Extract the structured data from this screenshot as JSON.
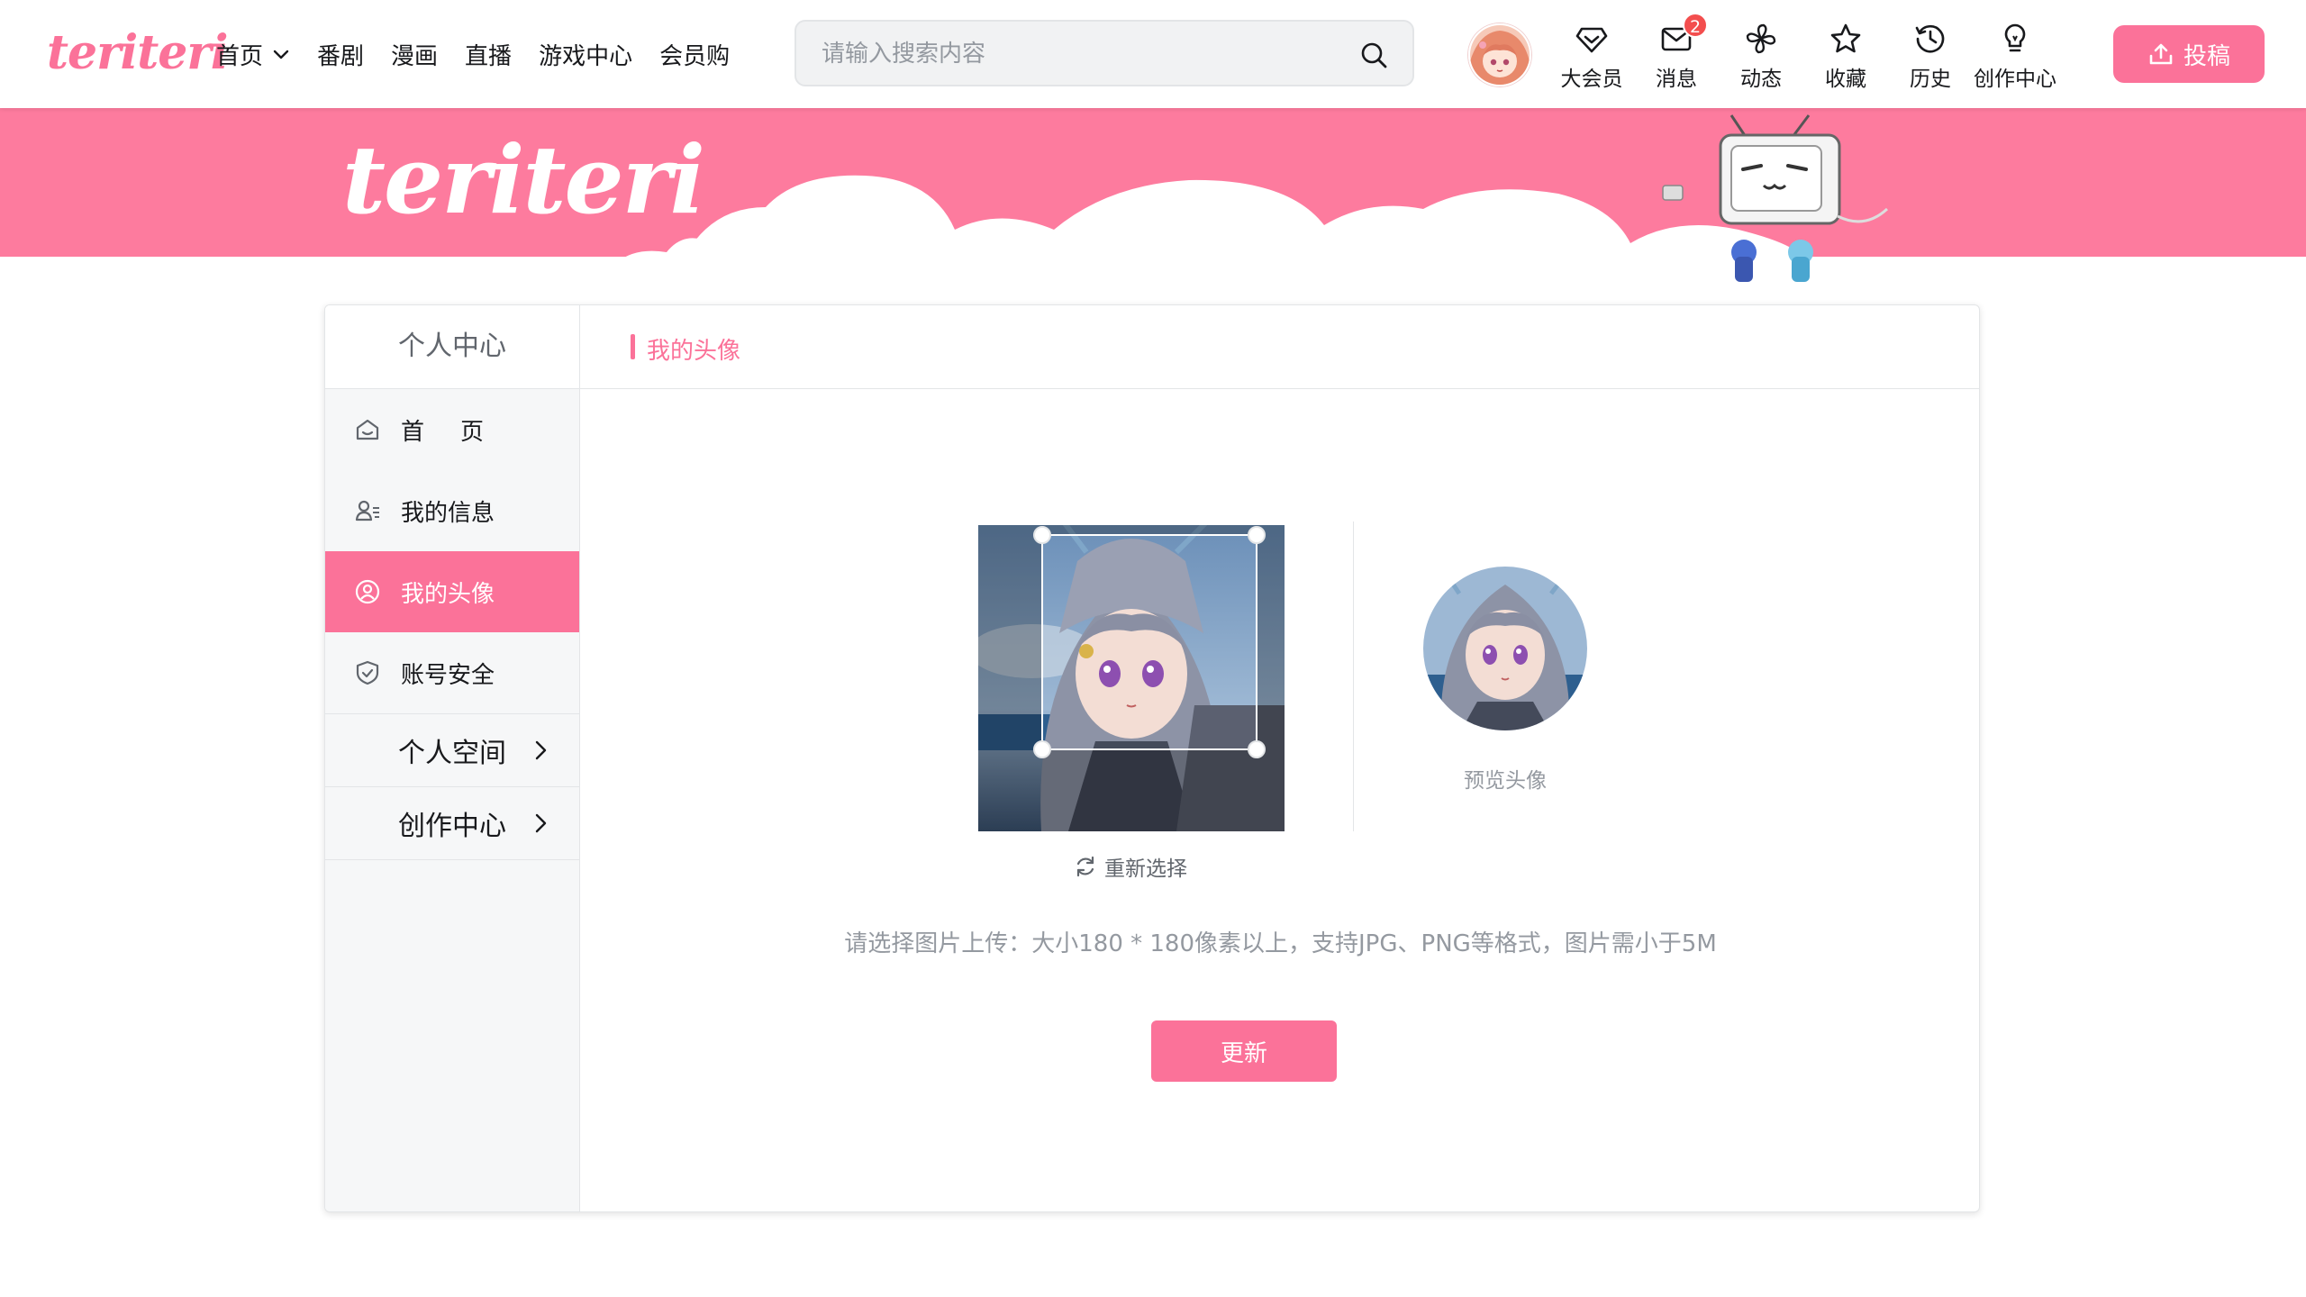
{
  "brand": {
    "logo_text": "teriteri",
    "accent": "#fb7299"
  },
  "nav": {
    "items": [
      "首页",
      "番剧",
      "漫画",
      "直播",
      "游戏中心",
      "会员购"
    ]
  },
  "search": {
    "placeholder": "请输入搜索内容"
  },
  "header_entries": [
    {
      "label": "大会员",
      "icon": "diamond-icon"
    },
    {
      "label": "消息",
      "icon": "mail-icon",
      "badge": "2"
    },
    {
      "label": "动态",
      "icon": "pinwheel-icon"
    },
    {
      "label": "收藏",
      "icon": "star-icon"
    },
    {
      "label": "历史",
      "icon": "history-icon"
    },
    {
      "label": "创作中心",
      "icon": "lightbulb-icon"
    }
  ],
  "upload": {
    "label": "投稿"
  },
  "banner": {
    "title": "teriteri"
  },
  "sidebar": {
    "title": "个人中心",
    "items": [
      {
        "label": "首页",
        "icon": "home-icon"
      },
      {
        "label": "我的信息",
        "icon": "user-info-icon"
      },
      {
        "label": "我的头像",
        "icon": "avatar-icon"
      },
      {
        "label": "账号安全",
        "icon": "shield-icon"
      }
    ],
    "links": [
      {
        "label": "个人空间"
      },
      {
        "label": "创作中心"
      }
    ]
  },
  "content": {
    "title": "我的头像",
    "reselect_label": "重新选择",
    "preview_label": "预览头像",
    "hint": "请选择图片上传：大小180 * 180像素以上，支持JPG、PNG等格式，图片需小于5M",
    "update_label": "更新"
  }
}
